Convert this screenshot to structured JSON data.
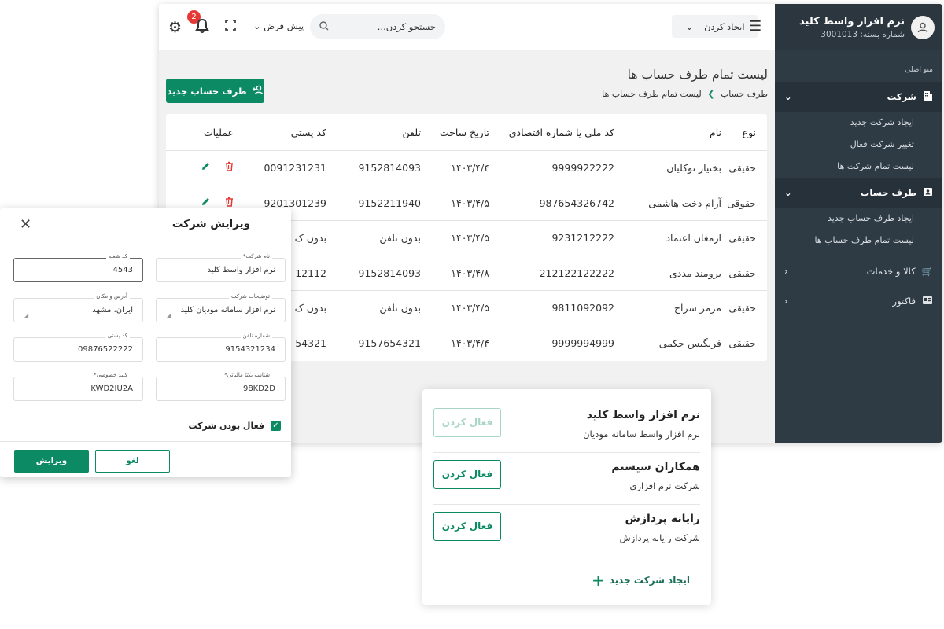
{
  "app": {
    "name": "نرم افزار واسط کلید",
    "package_label": "شماره بسته: 3001013"
  },
  "sidebar": {
    "menu_label": "منو اصلی",
    "sections": [
      {
        "label": "شرکت",
        "icon": "building-icon",
        "expanded": true,
        "items": [
          "ایجاد شرکت جدید",
          "تغییر شرکت فعال",
          "لیست تمام شرکت ها"
        ]
      },
      {
        "label": "طرف حساب",
        "icon": "contact-icon",
        "expanded": true,
        "items": [
          "ایجاد طرف حساب جدید",
          "لیست تمام طرف حساب ها"
        ]
      },
      {
        "label": "کالا و خدمات",
        "icon": "cart-icon",
        "expanded": false,
        "items": []
      },
      {
        "label": "فاکتور",
        "icon": "invoice-icon",
        "expanded": false,
        "items": []
      }
    ]
  },
  "topbar": {
    "create_label": "ایجاد کردن",
    "search_placeholder": "جستجو کردن...",
    "default_label": "پیش فرض",
    "notification_count": "2"
  },
  "page": {
    "title": "لیست تمام طرف حساب ها",
    "breadcrumb": [
      "طرف حساب",
      "لیست تمام طرف حساب ها"
    ],
    "add_button": "طرف حساب جدید"
  },
  "table": {
    "headers": [
      "نوع",
      "نام",
      "کد ملی یا شماره اقتصادی",
      "تاریخ ساخت",
      "تلفن",
      "کد پستی",
      "عملیات"
    ],
    "rows": [
      [
        "حقیقی",
        "بختیار توکلیان",
        "9999922222",
        "۱۴۰۳/۴/۴",
        "9152814093",
        "0091231231"
      ],
      [
        "حقوقی",
        "آرام دخت هاشمی",
        "987654326742",
        "۱۴۰۳/۴/۵",
        "9152211940",
        "9201301239"
      ],
      [
        "حقیقی",
        "ارمغان اعتماد",
        "9231212222",
        "۱۴۰۳/۴/۵",
        "بدون تلفن",
        "بدون ک"
      ],
      [
        "حقیقی",
        "برومند مددی",
        "212122122222",
        "۱۴۰۳/۴/۸",
        "9152814093",
        "12112"
      ],
      [
        "حقیقی",
        "مرمر سراج",
        "9811092092",
        "۱۴۰۳/۴/۵",
        "بدون تلفن",
        "بدون ک"
      ],
      [
        "حقیقی",
        "فرنگیس حکمی",
        "9999994999",
        "۱۴۰۳/۴/۴",
        "9157654321",
        "54321"
      ]
    ]
  },
  "dialog": {
    "title": "ویرایش شرکت",
    "fields": {
      "company_name": {
        "label": "نام شرکت*",
        "value": "نرم افزار واسط کلید"
      },
      "branch_code": {
        "label": "کد شعبه",
        "value": "4543"
      },
      "description": {
        "label": "توضیحات شرکت",
        "value": "نرم افزار سامانه مودیان کلید"
      },
      "address": {
        "label": "آدرس و مکان",
        "value": "ایران، مشهد"
      },
      "phone": {
        "label": "شماره تلفن",
        "value": "9154321234"
      },
      "postal": {
        "label": "کد پستی",
        "value": "09876522222"
      },
      "tax_id": {
        "label": "شناسه یکتا مالیاتی*",
        "value": "98KD2D"
      },
      "private_key": {
        "label": "کلید خصوصی*",
        "value": "KWD2IU2A"
      }
    },
    "active_label": "فعال بودن شرکت",
    "cancel_label": "لغو",
    "submit_label": "ویرایش"
  },
  "switcher": {
    "companies": [
      {
        "name": "نرم افزار واسط کلید",
        "desc": "نرم افزار واسط سامانه مودیان",
        "button": "فعال کردن",
        "disabled": true
      },
      {
        "name": "همکاران سیستم",
        "desc": "شرکت نرم افزاری",
        "button": "فعال کردن",
        "disabled": false
      },
      {
        "name": "رایانه پردازش",
        "desc": "شرکت رایانه پردازش",
        "button": "فعال کردن",
        "disabled": false
      }
    ],
    "new_company": "ایجاد شرکت جدید"
  },
  "colors": {
    "primary": "#0c8a64",
    "sidebar": "#2e3b45",
    "danger": "#e53935"
  }
}
